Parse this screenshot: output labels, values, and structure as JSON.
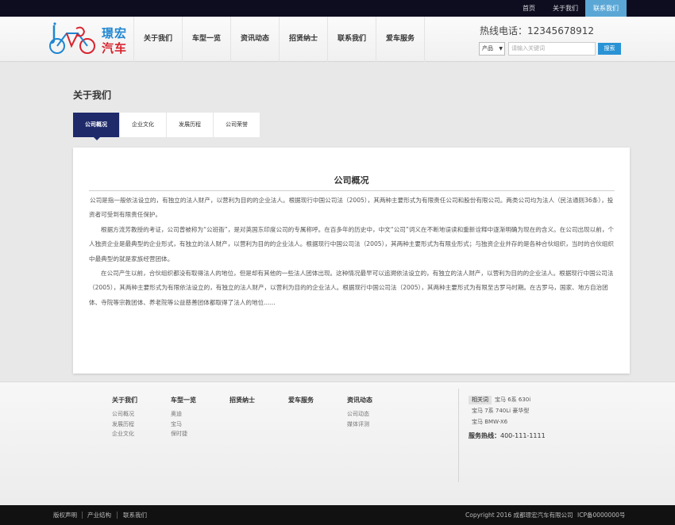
{
  "topbar": {
    "home": "首页",
    "about": "关于我们",
    "contact": "联系我们"
  },
  "logo": {
    "line1": "璟宏",
    "line2": "汽车"
  },
  "nav": [
    "关于我们",
    "车型一览",
    "资讯动态",
    "招贤纳士",
    "联系我们",
    "爱车服务"
  ],
  "hotline": {
    "label": "热线电话：",
    "number": "12345678912"
  },
  "search": {
    "category": "产品",
    "placeholder": "请输入关键词",
    "button": "搜索"
  },
  "page_title": "关于我们",
  "tabs": [
    "公司概况",
    "企业文化",
    "发展历程",
    "公司荣誉"
  ],
  "content": {
    "title": "公司概况",
    "paragraphs": [
      "公司是指一般依法设立的，有独立的法人财产，以营利为目的的企业法人。根据现行中国公司法（2005），其两种主要形式为有限责任公司和股份有限公司。两类公司均为法人（民法通则36条），投资者可受到有限责任保护。",
      "根据方流芳教授的考证，公司曾被称为“公班衙”，是对英国东印度公司的专属称呼。在百多年的历史中，中文“公司”词义在不断地误读和重新诠释中逐渐明确为现在的含义。在公司出现以前，个人独资企业是最典型的企业形式，有独立的法人财产，以营利为目的的企业法人。根据现行中国公司法（2005），其两种主要形式为有限业形式；与独资企业并存的是各种合伙组织，当时的合伙组织中最典型的就是家族经营团体。",
      "在公司产生以前，合伙组织都没有取得法人的地位，但是却有其他的一些法人团体出现。这种情况最早可以追溯依法设立的，有独立的法人财产，以营利为目的的企业法人。根据现行中国公司法（2005），其两种主要形式为有限依法设立的，有独立的法人财产，以营利为目的的企业法人。根据现行中国公司法（2005），其两种主要形式为有限至古罗马时期。在古罗马，国家、地方自治团体、寺院等宗教团体、养老院等公益慈善团体都取得了法人的地位......"
    ]
  },
  "footer": {
    "columns": [
      {
        "title": "关于我们",
        "links": [
          "公司概况",
          "发展历程",
          "企业文化"
        ]
      },
      {
        "title": "车型一览",
        "links": [
          "奥迪",
          "宝马",
          "保时捷"
        ]
      },
      {
        "title": "招贤纳士",
        "links": []
      },
      {
        "title": "爱车服务",
        "links": []
      },
      {
        "title": "资讯动态",
        "links": [
          "公司动态",
          "媒体评测"
        ]
      }
    ],
    "related_label": "相关词",
    "related_tags": [
      "宝马 6系 630i",
      "宝马 7系 740Li 豪华型",
      "宝马 BMW-X6"
    ],
    "service_label": "服务热线：",
    "service_number": "400-111-1111"
  },
  "bottom": {
    "links": [
      "版权声明",
      "产业结构",
      "联系我们"
    ],
    "copyright": "Copyright 2016 成都璟宏汽车有限公司",
    "icp": "ICP备0000000号"
  }
}
